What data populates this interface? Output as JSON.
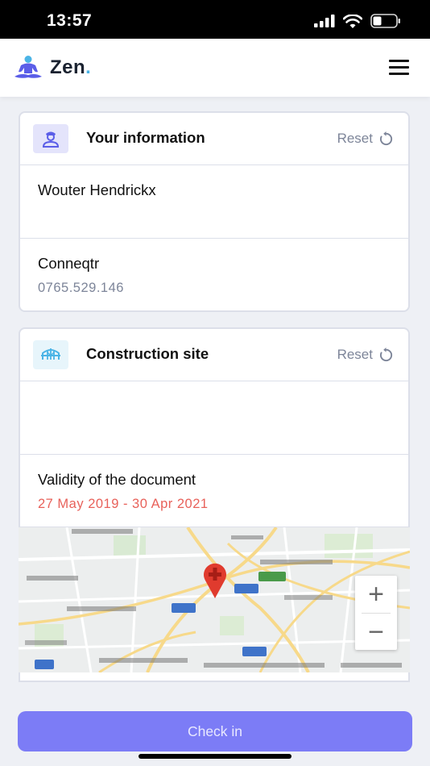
{
  "status_bar": {
    "time": "13:57"
  },
  "header": {
    "logo_text": "Zen",
    "logo_dot": ".",
    "logo_icon": "meditation-person-icon",
    "menu_icon": "hamburger-menu-icon"
  },
  "info_card": {
    "icon": "person-icon",
    "title": "Your information",
    "reset_label": "Reset",
    "name": "Wouter Hendrickx",
    "company": "Conneqtr",
    "company_number": "0765.529.146"
  },
  "site_card": {
    "icon": "crane-bridge-icon",
    "title": "Construction site",
    "reset_label": "Reset",
    "site_value": "",
    "validity_label": "Validity of the document",
    "validity_dates": "27 May 2019 - 30 Apr 2021"
  },
  "map": {
    "zoom_in": "+",
    "zoom_out": "−",
    "marker_icon": "map-marker-icon"
  },
  "footer": {
    "checkin_label": "Check in"
  },
  "colors": {
    "accent": "#7c7cf6",
    "danger": "#e8615a",
    "muted": "#7d8599",
    "marker": "#e03b2e"
  }
}
